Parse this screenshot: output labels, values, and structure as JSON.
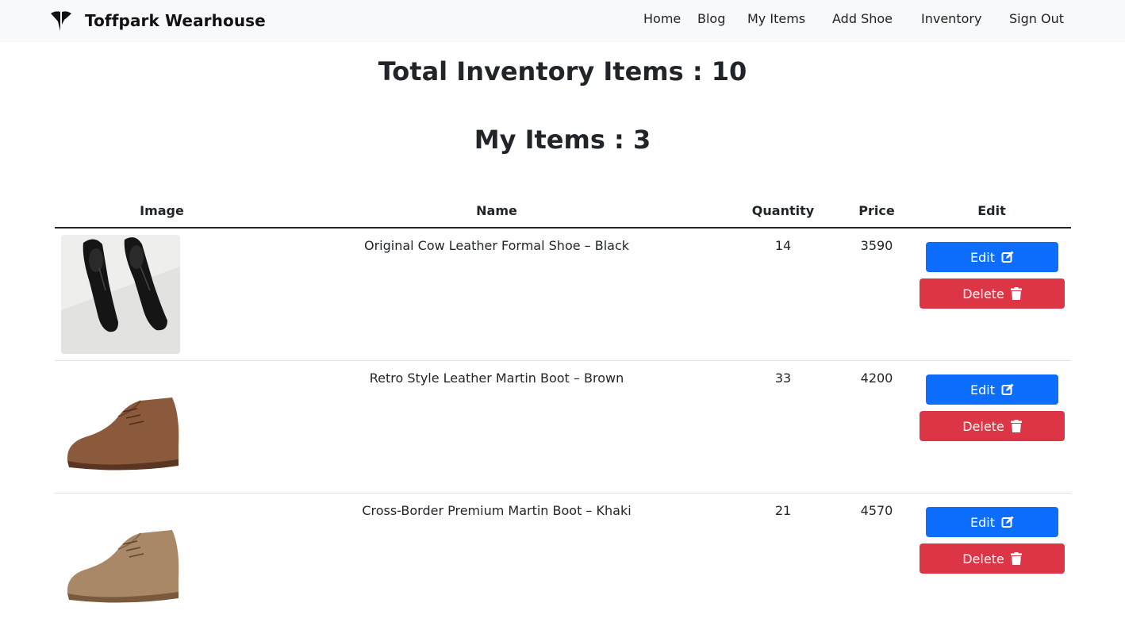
{
  "navbar": {
    "brand": "Toffpark Wearhouse",
    "links": [
      "Home",
      "Blog",
      "My Items",
      "Add Shoe",
      "Inventory",
      "Sign Out"
    ]
  },
  "headings": {
    "total_inventory": "Total Inventory Items : 10",
    "my_items": "My Items : 3"
  },
  "table": {
    "columns": [
      "Image",
      "Name",
      "Quantity",
      "Price",
      "Edit"
    ],
    "rows": [
      {
        "name": "Original Cow Leather Formal Shoe – Black",
        "quantity": "14",
        "price": "3590",
        "edit_label": "Edit",
        "delete_label": "Delete"
      },
      {
        "name": "Retro Style Leather Martin Boot – Brown",
        "quantity": "33",
        "price": "4200",
        "edit_label": "Edit",
        "delete_label": "Delete"
      },
      {
        "name": "Cross-Border Premium Martin Boot – Khaki",
        "quantity": "21",
        "price": "4570",
        "edit_label": "Edit",
        "delete_label": "Delete"
      }
    ]
  },
  "colors": {
    "primary": "#0d6efd",
    "danger": "#dc3545",
    "navbar_bg": "#f8f9fa"
  }
}
